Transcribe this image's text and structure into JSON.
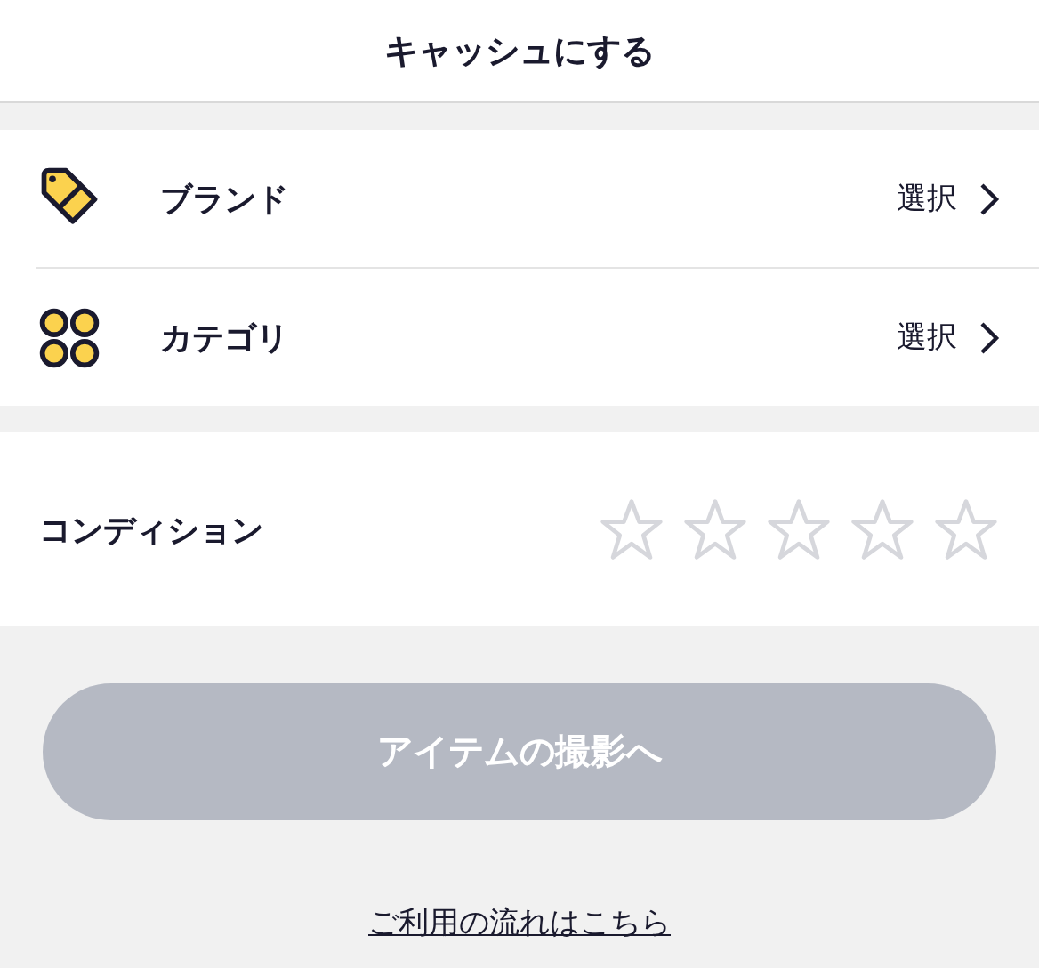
{
  "header": {
    "title": "キャッシュにする"
  },
  "rows": [
    {
      "kind": "tag",
      "label": "ブランド",
      "value": "選択"
    },
    {
      "kind": "dots",
      "label": "カテゴリ",
      "value": "選択"
    }
  ],
  "condition": {
    "label": "コンディション",
    "stars": 0
  },
  "primary_button": {
    "label": "アイテムの撮影へ",
    "disabled": true
  },
  "help_link": "ご利用の流れはこちら"
}
